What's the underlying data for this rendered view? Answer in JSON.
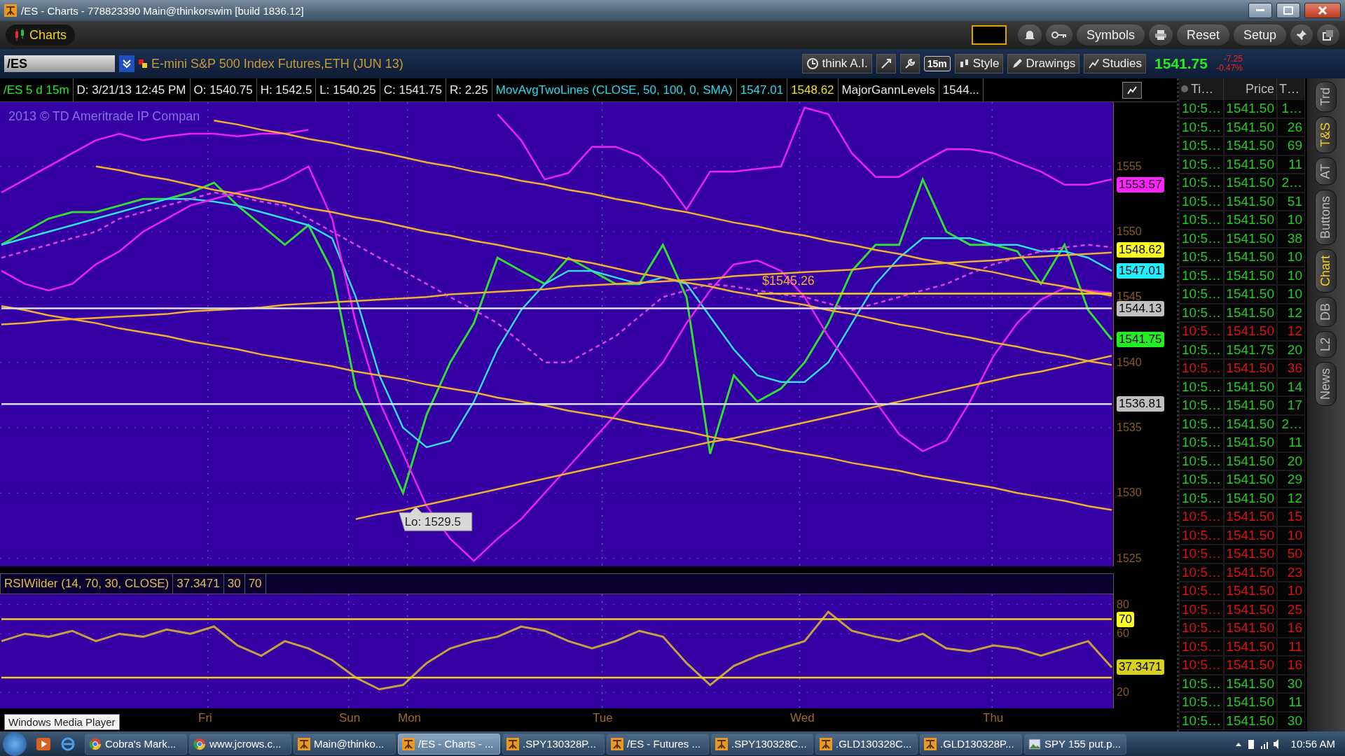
{
  "window": {
    "title": "/ES - Charts - 778823390 Main@thinkorswim [build 1836.12]"
  },
  "toolbar": {
    "tab": "Charts",
    "buttons": [
      "Symbols",
      "Reset",
      "Setup"
    ]
  },
  "symbol_bar": {
    "symbol": "/ES",
    "description": "E-mini S&P 500 Index Futures,ETH (JUN 13)",
    "think_ai": "think A.I.",
    "interval": "15m",
    "style": "Style",
    "drawings": "Drawings",
    "studies": "Studies",
    "last": "1541.75",
    "change": "-7.25",
    "change_pct": "-0.47%"
  },
  "info_bar": [
    {
      "text": "/ES 5 d 15m",
      "kind": "symbol"
    },
    {
      "text": "D: 3/21/13 12:45 PM",
      "kind": "plain"
    },
    {
      "text": "O: 1540.75",
      "kind": "plain"
    },
    {
      "text": "H: 1542.5",
      "kind": "plain"
    },
    {
      "text": "L: 1540.25",
      "kind": "plain"
    },
    {
      "text": "C: 1541.75",
      "kind": "plain"
    },
    {
      "text": "R: 2.25",
      "kind": "plain"
    },
    {
      "text": "MovAvgTwoLines (CLOSE, 50, 100, 0, SMA)",
      "kind": "study"
    },
    {
      "text": "1547.01",
      "kind": "study"
    },
    {
      "text": "1548.62",
      "kind": "second"
    },
    {
      "text": "MajorGannLevels",
      "kind": "plain"
    },
    {
      "text": "1544...",
      "kind": "plain"
    }
  ],
  "price_chart": {
    "copyright": "2013 © TD Ameritrade IP Compan",
    "low_callout": "Lo: 1529.5",
    "level_label": "$1545.26",
    "price_tags": [
      {
        "text": "1553.57",
        "color": "#ff22ff"
      },
      {
        "text": "1548.62",
        "color": "#ffff22"
      },
      {
        "text": "1547.01",
        "color": "#22eeff"
      },
      {
        "text": "1544.13",
        "color": "#c0c0c0"
      },
      {
        "text": "1541.75",
        "color": "#22ee22"
      },
      {
        "text": "1536.81",
        "color": "#c0c0c0"
      }
    ],
    "chart_data": {
      "type": "line",
      "ylim": [
        1524.4,
        1559.9
      ],
      "yticks": [
        1525,
        1530,
        1535,
        1540,
        1545,
        1550,
        1555
      ],
      "grid": true,
      "series": [
        {
          "color": "#33dd33",
          "values": [
            1549,
            1550,
            1551,
            1551.5,
            1551.5,
            1552,
            1552.5,
            1552.5,
            1553,
            1553.75,
            1552,
            1550.5,
            1549,
            1550.5,
            1547,
            1538,
            1534,
            1530,
            1536,
            1540,
            1543,
            1548,
            1547,
            1546,
            1548,
            1547,
            1546,
            1546,
            1549,
            1545,
            1533,
            1539,
            1537,
            1538,
            1540,
            1543,
            1547,
            1549,
            1549,
            1554,
            1550,
            1549,
            1549,
            1548.5,
            1546,
            1549,
            1544,
            1541.75
          ]
        },
        {
          "color": "#33ddee",
          "values": [
            1549,
            1549.5,
            1550,
            1550.5,
            1551,
            1551.5,
            1552,
            1552.5,
            1552.5,
            1552.3,
            1552,
            1551.5,
            1551,
            1550.5,
            1549.5,
            1545,
            1539,
            1535,
            1533.5,
            1534,
            1537,
            1541,
            1544,
            1546,
            1547,
            1547,
            1546.5,
            1546,
            1546.5,
            1546,
            1543.5,
            1541,
            1539,
            1538.5,
            1538.5,
            1540,
            1543,
            1546,
            1548,
            1549.5,
            1549.5,
            1549.5,
            1549,
            1549,
            1548.5,
            1548.5,
            1548,
            1547
          ]
        },
        {
          "color": "#ee22ee",
          "values": [
            1553,
            1554,
            1555,
            1556,
            1557,
            1557.5,
            1557,
            1557.3,
            1557.5,
            1557.5,
            1557.3,
            1557.5,
            1557.5,
            1557.8,
            null,
            null,
            null,
            null,
            null,
            null,
            null,
            1559,
            1557,
            1554,
            1554.5,
            1556.5,
            1556.5,
            1555.8,
            1554.2,
            1551.7,
            1554.6,
            1554.6,
            1554.8,
            1555,
            1559.5,
            1559,
            1556,
            1554.2,
            1554.2,
            1555.3,
            1556.3,
            1556.3,
            1556,
            1555.3,
            1554.6,
            1553.6,
            1553.6,
            1554
          ]
        },
        {
          "color": "#ee22ee",
          "values": [
            1547,
            1546,
            1545.5,
            1546,
            1547.5,
            1548.5,
            1550,
            1551,
            1552,
            1552.5,
            1553,
            1553.3,
            1554,
            1555,
            1551,
            1543,
            1537,
            1533,
            1529,
            1526.5,
            1524.8,
            1526.5,
            1528,
            1530,
            1532,
            1534,
            1536,
            1538,
            1540,
            1543,
            1545.5,
            1547.5,
            1547.8,
            1547,
            1545,
            1542,
            1539.5,
            1537,
            1534.5,
            1533.2,
            1534,
            1537,
            1540.5,
            1543,
            1544.8,
            1545.7,
            1545.5,
            1545.3
          ]
        },
        {
          "color": "#dd44dd",
          "line_style": "dashed",
          "values": [
            1548,
            1548.5,
            1549,
            1549.5,
            1550,
            1551,
            1551.5,
            1552,
            1552.5,
            1553,
            1552.7,
            1552.3,
            1552,
            1551,
            1550,
            1549,
            1548,
            1547,
            1546,
            1545,
            1544,
            1543,
            1541.5,
            1540,
            1540,
            1541,
            1542,
            1543.5,
            1545,
            1545.5,
            1546,
            1545.8,
            1545.5,
            1545.2,
            1545,
            1544.5,
            1544,
            1544.5,
            1545,
            1545.5,
            1546,
            1546.8,
            1547.5,
            1548,
            1548.5,
            1548.8,
            1549,
            1548.8
          ]
        },
        {
          "color": "#f0b030",
          "values": [
            null,
            null,
            null,
            null,
            null,
            null,
            null,
            null,
            null,
            1558.5,
            1558.2,
            1557.8,
            1557.5,
            1557.1,
            1556.8,
            1556.4,
            1556.1,
            1555.7,
            1555.3,
            1555,
            1554.6,
            1554.3,
            1553.9,
            1553.6,
            1553.2,
            1552.9,
            1552.5,
            1552.2,
            1551.8,
            1551.5,
            1551.1,
            1550.7,
            1550.4,
            1550,
            1549.7,
            1549.3,
            1549,
            1548.6,
            1548.3,
            1547.9,
            1547.6,
            1547.2,
            1546.9,
            1546.5,
            1546.1,
            1545.8,
            1545.4,
            1545.1
          ]
        },
        {
          "color": "#f0b030",
          "values": [
            null,
            null,
            null,
            null,
            1555,
            1554.7,
            1554.3,
            1554,
            1553.6,
            1553.2,
            1552.9,
            1552.5,
            1552.2,
            1551.8,
            1551.5,
            1551.1,
            1550.8,
            1550.4,
            1550,
            1549.7,
            1549.3,
            1549,
            1548.6,
            1548.3,
            1547.9,
            1547.6,
            1547.2,
            1546.8,
            1546.5,
            1546.1,
            1545.8,
            1545.4,
            1545.1,
            1544.7,
            1544.4,
            1544,
            1543.7,
            1543.3,
            1542.9,
            1542.6,
            1542.2,
            1541.9,
            1541.5,
            1541.2,
            1540.8,
            1540.5,
            1540.1,
            1539.8
          ]
        },
        {
          "color": "#f0b030",
          "values": [
            1544.3,
            1544,
            1543.6,
            1543.3,
            1543,
            1542.6,
            1542.3,
            1542,
            1541.6,
            1541.3,
            1541,
            1540.6,
            1540.3,
            1540,
            1539.7,
            1539.3,
            1539,
            1538.7,
            1538.3,
            1538,
            1537.7,
            1537.3,
            1537,
            1536.7,
            1536.3,
            1536,
            1535.7,
            1535.3,
            1535,
            1534.7,
            1534.3,
            1534,
            1533.7,
            1533.3,
            1533,
            1532.7,
            1532.3,
            1532,
            1531.7,
            1531.3,
            1531,
            1530.7,
            1530.4,
            1530,
            1529.7,
            1529.4,
            1529,
            1528.7
          ]
        },
        {
          "color": "#f0b030",
          "values": [
            1542.9,
            1543,
            1543.2,
            1543.3,
            1543.4,
            1543.5,
            1543.6,
            1543.7,
            1543.9,
            1544,
            1544.1,
            1544.2,
            1544.4,
            1544.5,
            1544.6,
            1544.7,
            1544.8,
            1544.9,
            1545,
            1545.2,
            1545.3,
            1545.4,
            1545.5,
            1545.6,
            1545.8,
            1545.9,
            1546,
            1546.1,
            1546.2,
            1546.3,
            1546.4,
            1546.6,
            1546.7,
            1546.8,
            1546.9,
            1547,
            1547.1,
            1547.3,
            1547.4,
            1547.5,
            1547.6,
            1547.7,
            1547.8,
            1548,
            1548.1,
            1548.2,
            1548.3,
            1548.4
          ]
        },
        {
          "color": "#f0b030",
          "values": [
            null,
            null,
            null,
            null,
            null,
            null,
            null,
            null,
            null,
            null,
            null,
            null,
            null,
            null,
            null,
            1528,
            1528.4,
            1528.7,
            1529.1,
            1529.5,
            1529.9,
            1530.3,
            1530.7,
            1531.1,
            1531.5,
            1531.9,
            1532.3,
            1532.7,
            1533.1,
            1533.5,
            1533.9,
            1534.2,
            1534.6,
            1535,
            1535.4,
            1535.8,
            1536.2,
            1536.6,
            1537,
            1537.4,
            1537.8,
            1538.2,
            1538.6,
            1539,
            1539.3,
            1539.7,
            1540.1,
            1540.5
          ]
        },
        {
          "color": "#f8d020",
          "values": [
            null,
            null,
            null,
            null,
            null,
            null,
            null,
            null,
            null,
            null,
            null,
            null,
            null,
            null,
            null,
            null,
            null,
            null,
            null,
            null,
            null,
            null,
            null,
            null,
            null,
            null,
            null,
            null,
            null,
            null,
            null,
            null,
            1545.26,
            1545.26,
            1545.26,
            1545.26,
            1545.26,
            1545.26,
            1545.26,
            1545.26,
            1545.26,
            1545.26,
            1545.26,
            1545.26,
            1545.26,
            1545.26,
            1545.26,
            1545.26
          ]
        },
        {
          "color": "#dddddd",
          "values": [
            1544.13,
            1544.13,
            1544.13,
            1544.13,
            1544.13,
            1544.13,
            1544.13,
            1544.13,
            1544.13,
            1544.13,
            1544.13,
            1544.13,
            1544.13,
            1544.13,
            1544.13,
            1544.13,
            1544.13,
            1544.13,
            1544.13,
            1544.13,
            1544.13,
            1544.13,
            1544.13,
            1544.13,
            1544.13,
            1544.13,
            1544.13,
            1544.13,
            1544.13,
            1544.13,
            1544.13,
            1544.13,
            1544.13,
            1544.13,
            1544.13,
            1544.13,
            1544.13,
            1544.13,
            1544.13,
            1544.13,
            1544.13,
            1544.13,
            1544.13,
            1544.13,
            1544.13,
            1544.13,
            1544.13,
            1544.13
          ]
        },
        {
          "color": "#dddddd",
          "values": [
            1536.81,
            1536.81,
            1536.81,
            1536.81,
            1536.81,
            1536.81,
            1536.81,
            1536.81,
            1536.81,
            1536.81,
            1536.81,
            1536.81,
            1536.81,
            1536.81,
            1536.81,
            1536.81,
            1536.81,
            1536.81,
            1536.81,
            1536.81,
            1536.81,
            1536.81,
            1536.81,
            1536.81,
            1536.81,
            1536.81,
            1536.81,
            1536.81,
            1536.81,
            1536.81,
            1536.81,
            1536.81,
            1536.81,
            1536.81,
            1536.81,
            1536.81,
            1536.81,
            1536.81,
            1536.81,
            1536.81,
            1536.81,
            1536.81,
            1536.81,
            1536.81,
            1536.81,
            1536.81,
            1536.81,
            1536.81
          ]
        }
      ]
    }
  },
  "rsi": {
    "header": [
      "RSIWilder (14, 70, 30, CLOSE)",
      "37.3471",
      "30",
      "70"
    ],
    "tags": [
      {
        "text": "70",
        "color": "#ffff22"
      },
      {
        "text": "37.3471",
        "color": "#d8d020"
      }
    ],
    "chart_data": {
      "type": "line",
      "ylim": [
        9,
        87
      ],
      "yticks": [
        20,
        60,
        80
      ],
      "grid": true,
      "series": [
        {
          "color": "#c8a040",
          "values": [
            55,
            60,
            58,
            62,
            55,
            60,
            58,
            63,
            60,
            65,
            52,
            45,
            55,
            50,
            42,
            30,
            22,
            25,
            40,
            50,
            55,
            58,
            65,
            62,
            55,
            50,
            55,
            62,
            58,
            40,
            25,
            38,
            45,
            50,
            55,
            75,
            62,
            58,
            55,
            60,
            50,
            48,
            52,
            50,
            45,
            50,
            55,
            37
          ]
        },
        {
          "color": "#f0d020",
          "values": [
            70,
            70,
            70,
            70,
            70,
            70,
            70,
            70,
            70,
            70,
            70,
            70,
            70,
            70,
            70,
            70,
            70,
            70,
            70,
            70,
            70,
            70,
            70,
            70,
            70,
            70,
            70,
            70,
            70,
            70,
            70,
            70,
            70,
            70,
            70,
            70,
            70,
            70,
            70,
            70,
            70,
            70,
            70,
            70,
            70,
            70,
            70,
            70
          ]
        },
        {
          "color": "#f0d020",
          "values": [
            30,
            30,
            30,
            30,
            30,
            30,
            30,
            30,
            30,
            30,
            30,
            30,
            30,
            30,
            30,
            30,
            30,
            30,
            30,
            30,
            30,
            30,
            30,
            30,
            30,
            30,
            30,
            30,
            30,
            30,
            30,
            30,
            30,
            30,
            30,
            30,
            30,
            30,
            30,
            30,
            30,
            30,
            30,
            30,
            30,
            30,
            30,
            30
          ]
        }
      ]
    }
  },
  "time_axis": [
    "Fri",
    "Sun",
    "Mon",
    "Tue",
    "Wed",
    "Thu"
  ],
  "tooltip": "Windows Media Player",
  "time_sales": {
    "columns": [
      "Ti…",
      "Price",
      "T…"
    ],
    "rows": [
      {
        "time": "10:5…",
        "price": "1541.50",
        "size": "1…",
        "kind": "up"
      },
      {
        "time": "10:5…",
        "price": "1541.50",
        "size": "26",
        "kind": "up"
      },
      {
        "time": "10:5…",
        "price": "1541.50",
        "size": "69",
        "kind": "up"
      },
      {
        "time": "10:5…",
        "price": "1541.50",
        "size": "11",
        "kind": "up"
      },
      {
        "time": "10:5…",
        "price": "1541.50",
        "size": "2…",
        "kind": "up"
      },
      {
        "time": "10:5…",
        "price": "1541.50",
        "size": "51",
        "kind": "up"
      },
      {
        "time": "10:5…",
        "price": "1541.50",
        "size": "10",
        "kind": "up"
      },
      {
        "time": "10:5…",
        "price": "1541.50",
        "size": "38",
        "kind": "up"
      },
      {
        "time": "10:5…",
        "price": "1541.50",
        "size": "10",
        "kind": "up"
      },
      {
        "time": "10:5…",
        "price": "1541.50",
        "size": "10",
        "kind": "up"
      },
      {
        "time": "10:5…",
        "price": "1541.50",
        "size": "10",
        "kind": "up"
      },
      {
        "time": "10:5…",
        "price": "1541.50",
        "size": "12",
        "kind": "up"
      },
      {
        "time": "10:5…",
        "price": "1541.50",
        "size": "12",
        "kind": "down"
      },
      {
        "time": "10:5…",
        "price": "1541.75",
        "size": "20",
        "kind": "up"
      },
      {
        "time": "10:5…",
        "price": "1541.50",
        "size": "36",
        "kind": "down"
      },
      {
        "time": "10:5…",
        "price": "1541.50",
        "size": "14",
        "kind": "up"
      },
      {
        "time": "10:5…",
        "price": "1541.50",
        "size": "17",
        "kind": "up"
      },
      {
        "time": "10:5…",
        "price": "1541.50",
        "size": "2…",
        "kind": "up"
      },
      {
        "time": "10:5…",
        "price": "1541.50",
        "size": "11",
        "kind": "up"
      },
      {
        "time": "10:5…",
        "price": "1541.50",
        "size": "20",
        "kind": "up"
      },
      {
        "time": "10:5…",
        "price": "1541.50",
        "size": "29",
        "kind": "up"
      },
      {
        "time": "10:5…",
        "price": "1541.50",
        "size": "12",
        "kind": "up"
      },
      {
        "time": "10:5…",
        "price": "1541.50",
        "size": "15",
        "kind": "down"
      },
      {
        "time": "10:5…",
        "price": "1541.50",
        "size": "10",
        "kind": "down"
      },
      {
        "time": "10:5…",
        "price": "1541.50",
        "size": "50",
        "kind": "down"
      },
      {
        "time": "10:5…",
        "price": "1541.50",
        "size": "23",
        "kind": "down"
      },
      {
        "time": "10:5…",
        "price": "1541.50",
        "size": "10",
        "kind": "down"
      },
      {
        "time": "10:5…",
        "price": "1541.50",
        "size": "25",
        "kind": "down"
      },
      {
        "time": "10:5…",
        "price": "1541.50",
        "size": "16",
        "kind": "down"
      },
      {
        "time": "10:5…",
        "price": "1541.50",
        "size": "11",
        "kind": "down"
      },
      {
        "time": "10:5…",
        "price": "1541.50",
        "size": "16",
        "kind": "down"
      },
      {
        "time": "10:5…",
        "price": "1541.50",
        "size": "30",
        "kind": "up"
      },
      {
        "time": "10:5…",
        "price": "1541.50",
        "size": "11",
        "kind": "up"
      },
      {
        "time": "10:5…",
        "price": "1541.50",
        "size": "30",
        "kind": "up"
      }
    ]
  },
  "side_tabs": [
    {
      "label": "Trd",
      "selected": false
    },
    {
      "label": "T&S",
      "selected": true
    },
    {
      "label": "AT",
      "selected": false
    },
    {
      "label": "Buttons",
      "selected": false
    },
    {
      "label": "Chart",
      "selected": true
    },
    {
      "label": "DB",
      "selected": false
    },
    {
      "label": "L2",
      "selected": false
    },
    {
      "label": "News",
      "selected": false
    }
  ],
  "taskbar": {
    "items": [
      {
        "label": "Cobra's Mark...",
        "kind": "browser",
        "selected": false
      },
      {
        "label": "www.jcrows.c...",
        "kind": "browser",
        "selected": false
      },
      {
        "label": "Main@thinko...",
        "kind": "trading",
        "selected": false
      },
      {
        "label": "/ES - Charts - ...",
        "kind": "trading",
        "selected": true
      },
      {
        "label": ".SPY130328P...",
        "kind": "trading",
        "selected": false
      },
      {
        "label": "/ES - Futures ...",
        "kind": "trading",
        "selected": false
      },
      {
        "label": ".SPY130328C...",
        "kind": "trading",
        "selected": false
      },
      {
        "label": ".GLD130328C...",
        "kind": "trading",
        "selected": false
      },
      {
        "label": ".GLD130328P...",
        "kind": "trading",
        "selected": false
      },
      {
        "label": "SPY 155 put.p...",
        "kind": "image",
        "selected": false
      }
    ],
    "clock": "10:56 AM"
  }
}
